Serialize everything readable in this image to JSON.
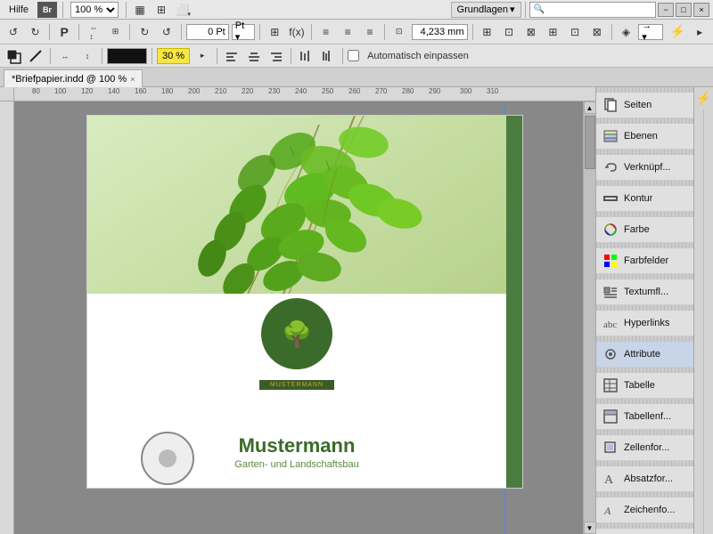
{
  "menubar": {
    "items": [
      "Hilfe"
    ],
    "br_label": "Br",
    "zoom_value": "100 %",
    "workspace_label": "Grundlagen",
    "search_placeholder": ""
  },
  "window_controls": {
    "minimize": "−",
    "maximize": "□",
    "close": "×"
  },
  "toolbar1": {
    "pt_value": "0 Pt",
    "mm_value": "4,233 mm",
    "auto_fit_label": "Automatisch einpassen"
  },
  "toolbar2": {
    "percent_value": "30 %"
  },
  "tabs": [
    {
      "label": "*Briefpapier.indd @ 100 %",
      "active": true
    }
  ],
  "right_panel": {
    "items": [
      {
        "id": "seiten",
        "label": "Seiten",
        "icon": "pages-icon"
      },
      {
        "id": "ebenen",
        "label": "Ebenen",
        "icon": "layers-icon"
      },
      {
        "id": "verknuepf",
        "label": "Verknüpf...",
        "icon": "links-icon"
      },
      {
        "id": "kontur",
        "label": "Kontur",
        "icon": "stroke-icon"
      },
      {
        "id": "farbe",
        "label": "Farbe",
        "icon": "color-icon"
      },
      {
        "id": "farbfelder",
        "label": "Farbfelder",
        "icon": "swatches-icon"
      },
      {
        "id": "textumfl",
        "label": "Textumfl...",
        "icon": "text-wrap-icon"
      },
      {
        "id": "hyperlinks",
        "label": "Hyperlinks",
        "icon": "hyperlinks-icon"
      },
      {
        "id": "attribute",
        "label": "Attribute",
        "icon": "attribute-icon"
      },
      {
        "id": "tabelle",
        "label": "Tabelle",
        "icon": "table-icon"
      },
      {
        "id": "tabellenf",
        "label": "Tabellenf...",
        "icon": "table-styles-icon"
      },
      {
        "id": "zellenfor",
        "label": "Zellenfor...",
        "icon": "cell-styles-icon"
      },
      {
        "id": "absatzfor",
        "label": "Absatzfor...",
        "icon": "para-styles-icon"
      },
      {
        "id": "zeichenfo",
        "label": "Zeichenfo...",
        "icon": "char-styles-icon"
      }
    ]
  },
  "document": {
    "title": "*Briefpapier.indd",
    "company_name": "Mustermann",
    "company_subtitle": "Garten- und Landschaftsbau",
    "logo_text": "MUSTERMANN"
  },
  "colors": {
    "green_dark": "#3a6b2a",
    "green_medium": "#5a8a3a",
    "green_light": "#6aaa30",
    "canvas_bg": "#888888",
    "panel_bg": "#e0e0e0",
    "toolbar_bg": "#e4e4e4",
    "tab_bg": "#f0f0f0",
    "highlight_yellow": "#f5e642"
  }
}
